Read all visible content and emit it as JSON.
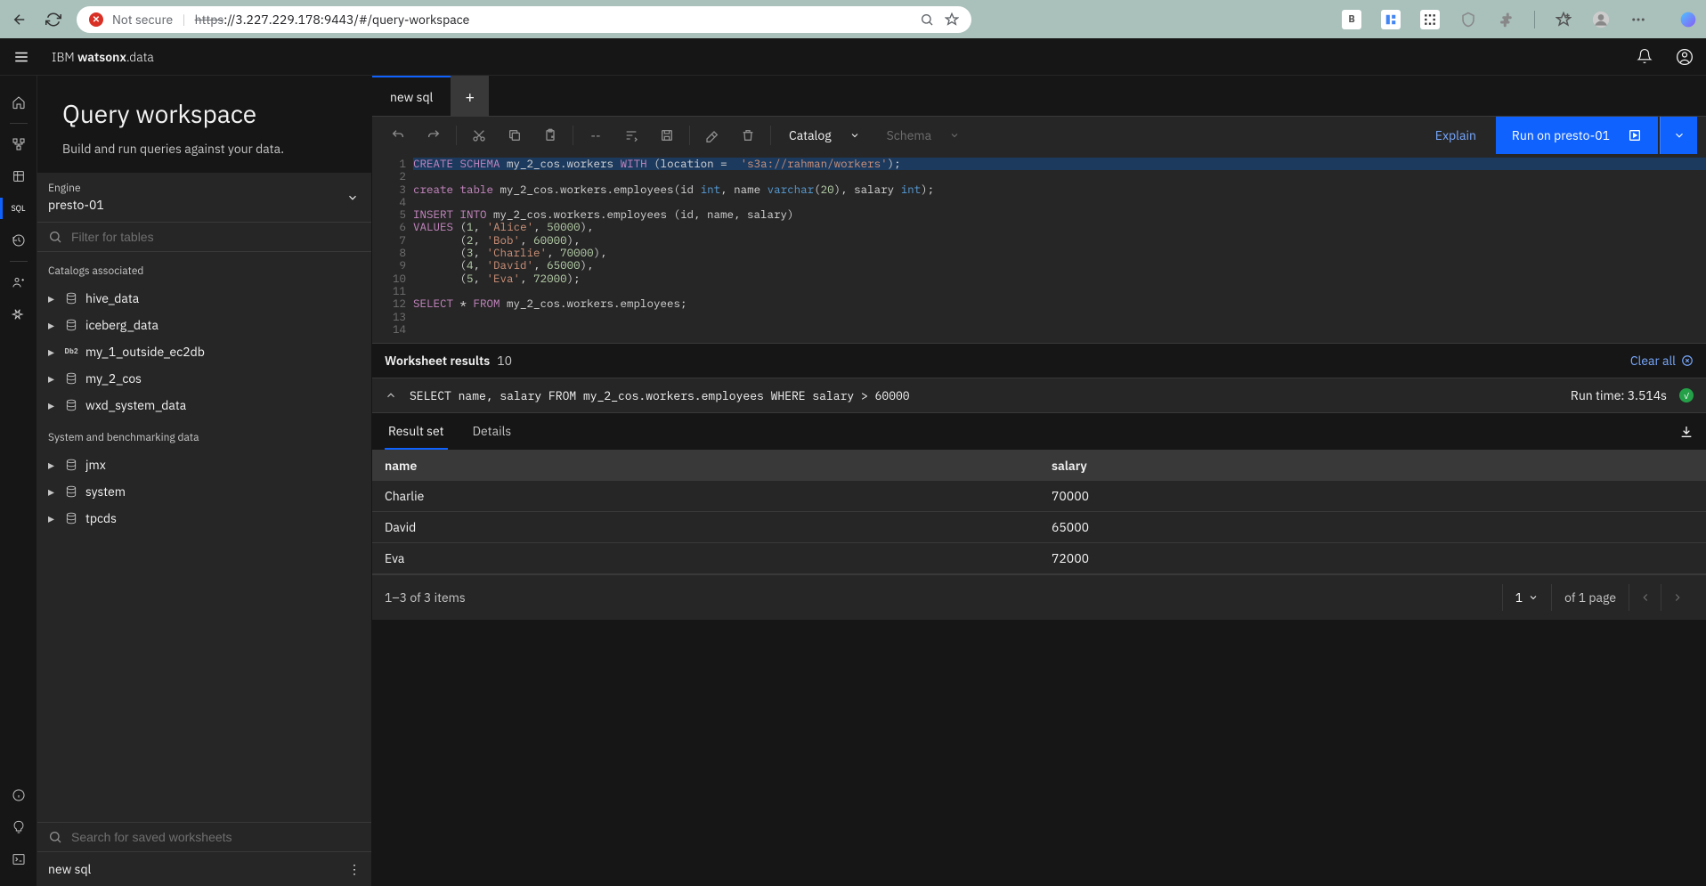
{
  "browser": {
    "not_secure": "Not secure",
    "url_scheme": "https",
    "url_rest": "://3.227.229.178:9443/#/query-workspace"
  },
  "header": {
    "brand_light": "IBM ",
    "brand_bold": "watsonx",
    "brand_suffix": ".data"
  },
  "rail_sql": "SQL",
  "page": {
    "title": "Query workspace",
    "subtitle": "Build and run queries against your data."
  },
  "engine": {
    "label": "Engine",
    "value": "presto-01"
  },
  "filter_tables_placeholder": "Filter for tables",
  "catalogs_label": "Catalogs associated",
  "catalogs": [
    {
      "name": "hive_data",
      "icon": "db"
    },
    {
      "name": "iceberg_data",
      "icon": "db"
    },
    {
      "name": "my_1_outside_ec2db",
      "icon": "db2"
    },
    {
      "name": "my_2_cos",
      "icon": "db"
    },
    {
      "name": "wxd_system_data",
      "icon": "db"
    }
  ],
  "system_label": "System and benchmarking data",
  "system_items": [
    {
      "name": "jmx"
    },
    {
      "name": "system"
    },
    {
      "name": "tpcds"
    }
  ],
  "search_worksheets_placeholder": "Search for saved worksheets",
  "worksheet_items": [
    "new sql"
  ],
  "tabs": {
    "active": "new sql"
  },
  "toolbar": {
    "catalog_label": "Catalog",
    "schema_label": "Schema",
    "explain": "Explain",
    "run": "Run on presto-01"
  },
  "editor_lines": [
    {
      "n": 1,
      "hl": true,
      "segments": [
        {
          "t": "CREATE",
          "c": "kw"
        },
        {
          "t": " "
        },
        {
          "t": "SCHEMA",
          "c": "kw"
        },
        {
          "t": " my_2_cos.workers "
        },
        {
          "t": "WITH",
          "c": "kw"
        },
        {
          "t": " (location =  "
        },
        {
          "t": "'s3a://rahman/workers'",
          "c": "str"
        },
        {
          "t": ");"
        }
      ]
    },
    {
      "n": 2,
      "segments": []
    },
    {
      "n": 3,
      "segments": [
        {
          "t": "create",
          "c": "kw"
        },
        {
          "t": " "
        },
        {
          "t": "table",
          "c": "kw"
        },
        {
          "t": " my_2_cos.workers.employees(id "
        },
        {
          "t": "int",
          "c": "type"
        },
        {
          "t": ", name "
        },
        {
          "t": "varchar",
          "c": "type"
        },
        {
          "t": "("
        },
        {
          "t": "20",
          "c": "num"
        },
        {
          "t": "), salary "
        },
        {
          "t": "int",
          "c": "type"
        },
        {
          "t": ");"
        }
      ]
    },
    {
      "n": 4,
      "segments": []
    },
    {
      "n": 5,
      "segments": [
        {
          "t": "INSERT",
          "c": "kw"
        },
        {
          "t": " "
        },
        {
          "t": "INTO",
          "c": "kw"
        },
        {
          "t": " my_2_cos.workers.employees (id, name, salary)"
        }
      ]
    },
    {
      "n": 6,
      "segments": [
        {
          "t": "VALUES",
          "c": "kw"
        },
        {
          "t": " ("
        },
        {
          "t": "1",
          "c": "num"
        },
        {
          "t": ", "
        },
        {
          "t": "'Alice'",
          "c": "str"
        },
        {
          "t": ", "
        },
        {
          "t": "50000",
          "c": "num"
        },
        {
          "t": "),"
        }
      ]
    },
    {
      "n": 7,
      "segments": [
        {
          "t": "       ("
        },
        {
          "t": "2",
          "c": "num"
        },
        {
          "t": ", "
        },
        {
          "t": "'Bob'",
          "c": "str"
        },
        {
          "t": ", "
        },
        {
          "t": "60000",
          "c": "num"
        },
        {
          "t": "),"
        }
      ]
    },
    {
      "n": 8,
      "segments": [
        {
          "t": "       ("
        },
        {
          "t": "3",
          "c": "num"
        },
        {
          "t": ", "
        },
        {
          "t": "'Charlie'",
          "c": "str"
        },
        {
          "t": ", "
        },
        {
          "t": "70000",
          "c": "num"
        },
        {
          "t": "),"
        }
      ]
    },
    {
      "n": 9,
      "segments": [
        {
          "t": "       ("
        },
        {
          "t": "4",
          "c": "num"
        },
        {
          "t": ", "
        },
        {
          "t": "'David'",
          "c": "str"
        },
        {
          "t": ", "
        },
        {
          "t": "65000",
          "c": "num"
        },
        {
          "t": "),"
        }
      ]
    },
    {
      "n": 10,
      "segments": [
        {
          "t": "       ("
        },
        {
          "t": "5",
          "c": "num"
        },
        {
          "t": ", "
        },
        {
          "t": "'Eva'",
          "c": "str"
        },
        {
          "t": ", "
        },
        {
          "t": "72000",
          "c": "num"
        },
        {
          "t": ");"
        }
      ]
    },
    {
      "n": 11,
      "segments": []
    },
    {
      "n": 12,
      "segments": [
        {
          "t": "SELECT",
          "c": "kw"
        },
        {
          "t": " * "
        },
        {
          "t": "FROM",
          "c": "kw"
        },
        {
          "t": " my_2_cos.workers.employees;"
        }
      ]
    },
    {
      "n": 13,
      "segments": []
    },
    {
      "n": 14,
      "segments": []
    }
  ],
  "results": {
    "title": "Worksheet results",
    "count": "10",
    "clear": "Clear all",
    "query": "SELECT name, salary FROM my_2_cos.workers.employees WHERE salary > 60000",
    "runtime": "Run time: 3.514s",
    "tab_result": "Result set",
    "tab_details": "Details",
    "columns": [
      "name",
      "salary"
    ],
    "rows": [
      [
        "Charlie",
        "70000"
      ],
      [
        "David",
        "65000"
      ],
      [
        "Eva",
        "72000"
      ]
    ],
    "pagination_summary": "1–3 of 3 items",
    "page_current": "1",
    "page_total": "of 1 page"
  }
}
